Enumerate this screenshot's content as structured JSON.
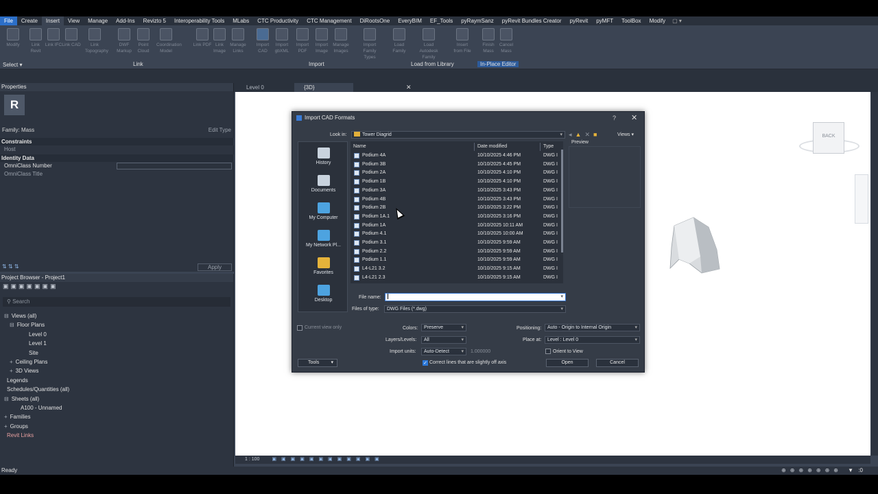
{
  "ribbon_tabs": [
    "File",
    "Create",
    "Insert",
    "View",
    "Manage",
    "Add-Ins",
    "Revizto 5",
    "Interoperability Tools",
    "MLabs",
    "CTC Productivity",
    "CTC Management",
    "DiRootsOne",
    "EveryBIM",
    "EF_Tools",
    "pyRaymSanz",
    "pyRevit Bundles Creator",
    "pyRevit",
    "pyMFT",
    "ToolBox",
    "Modify"
  ],
  "ribbon": {
    "buttons": [
      {
        "label": "Modify",
        "highlight": false
      },
      {
        "label": "Link Revit",
        "highlight": false
      },
      {
        "label": "Link IFC",
        "highlight": false
      },
      {
        "label": "Link CAD",
        "highlight": false
      },
      {
        "label": "Link Topography",
        "highlight": false
      },
      {
        "label": "DWF Markup",
        "highlight": false
      },
      {
        "label": "Point Cloud",
        "highlight": false
      },
      {
        "label": "Coordination Model",
        "highlight": false
      },
      {
        "label": "Link PDF",
        "highlight": false
      },
      {
        "label": "Link Image",
        "highlight": false
      },
      {
        "label": "Manage Links",
        "highlight": false
      },
      {
        "label": "Import CAD",
        "highlight": true
      },
      {
        "label": "Import gbXML",
        "highlight": false
      },
      {
        "label": "Import PDF",
        "highlight": false
      },
      {
        "label": "Import Image",
        "highlight": false
      },
      {
        "label": "Manage Images",
        "highlight": false
      },
      {
        "label": "Import Family Types",
        "highlight": false
      },
      {
        "label": "Load Family",
        "highlight": false
      },
      {
        "label": "Load Autodesk Family",
        "highlight": false
      },
      {
        "label": "Insert from File",
        "highlight": false
      },
      {
        "label": "Finish Mass",
        "highlight": false
      },
      {
        "label": "Cancel Mass",
        "highlight": false
      }
    ],
    "panels": {
      "select": "Select ▾",
      "link": "Link",
      "import": "Import",
      "load": "Load from Library",
      "inplace": "In-Place Editor"
    }
  },
  "properties": {
    "title": "Properties",
    "logo": "R",
    "family": "Family: Mass",
    "edit_type": "Edit Type",
    "sections": {
      "constraints": "Constraints",
      "identity": "Identity Data"
    },
    "rows": {
      "host": "Host",
      "omniclass_number": "OmniClass Number",
      "omniclass_title": "OmniClass Title"
    },
    "apply": "Apply"
  },
  "browser": {
    "title": "Project Browser - Project1",
    "search_placeholder": "Search",
    "items": [
      {
        "label": "Views (all)",
        "twist": "⊟",
        "indent": 6
      },
      {
        "label": "Floor Plans",
        "twist": "⊟",
        "indent": 14
      },
      {
        "label": "Level 0",
        "twist": "",
        "indent": 38
      },
      {
        "label": "Level 1",
        "twist": "",
        "indent": 38
      },
      {
        "label": "Site",
        "twist": "",
        "indent": 38
      },
      {
        "label": "Ceiling Plans",
        "twist": "+",
        "indent": 14
      },
      {
        "label": "3D Views",
        "twist": "+",
        "indent": 14
      },
      {
        "label": "Legends",
        "twist": "",
        "indent": 6
      },
      {
        "label": "Schedules/Quantities (all)",
        "twist": "",
        "indent": 6
      },
      {
        "label": "Sheets (all)",
        "twist": "⊟",
        "indent": 6
      },
      {
        "label": "A100 - Unnamed",
        "twist": "",
        "indent": 26
      },
      {
        "label": "Families",
        "twist": "+",
        "indent": 6
      },
      {
        "label": "Groups",
        "twist": "+",
        "indent": 6
      },
      {
        "label": "Revit Links",
        "twist": "",
        "indent": 6
      }
    ]
  },
  "view_tabs": {
    "level0": "Level 0",
    "3d": "{3D}"
  },
  "view_status": {
    "scale": "1 : 100"
  },
  "viewcube": {
    "label": "BACK"
  },
  "status": {
    "text": "Ready",
    "right": ":0"
  },
  "dialog": {
    "title": "Import CAD Formats",
    "help": "?",
    "look_in_label": "Look in:",
    "look_in_value": "Tower Diagrid",
    "views_btn": "Views",
    "preview": "Preview",
    "places": [
      "History",
      "Documents",
      "My Computer",
      "My Network Pl...",
      "Favorites",
      "Desktop"
    ],
    "columns": {
      "name": "Name",
      "date": "Date modified",
      "type": "Type"
    },
    "files": [
      {
        "name": "Podium 4A",
        "date": "10/10/2025 4:46 PM",
        "type": "DWG I"
      },
      {
        "name": "Podium 3B",
        "date": "10/10/2025 4:45 PM",
        "type": "DWG I"
      },
      {
        "name": "Podium 2A",
        "date": "10/10/2025 4:10 PM",
        "type": "DWG I"
      },
      {
        "name": "Podium 1B",
        "date": "10/10/2025 4:10 PM",
        "type": "DWG I"
      },
      {
        "name": "Podium 3A",
        "date": "10/10/2025 3:43 PM",
        "type": "DWG I"
      },
      {
        "name": "Podium 4B",
        "date": "10/10/2025 3:43 PM",
        "type": "DWG I"
      },
      {
        "name": "Podium 2B",
        "date": "10/10/2025 3:22 PM",
        "type": "DWG I"
      },
      {
        "name": "Podium 1A.1",
        "date": "10/10/2025 3:16 PM",
        "type": "DWG I"
      },
      {
        "name": "Podium 1A",
        "date": "10/10/2025 10:11 AM",
        "type": "DWG I"
      },
      {
        "name": "Podium 4.1",
        "date": "10/10/2025 10:00 AM",
        "type": "DWG I"
      },
      {
        "name": "Podium 3.1",
        "date": "10/10/2025 9:59 AM",
        "type": "DWG I"
      },
      {
        "name": "Podium 2.2",
        "date": "10/10/2025 9:59 AM",
        "type": "DWG I"
      },
      {
        "name": "Podium 1.1",
        "date": "10/10/2025 9:59 AM",
        "type": "DWG I"
      },
      {
        "name": "L4-L21 3.2",
        "date": "10/10/2025 9:15 AM",
        "type": "DWG I"
      },
      {
        "name": "L4-L21 2.3",
        "date": "10/10/2025 9:15 AM",
        "type": "DWG I"
      }
    ],
    "file_name_label": "File name:",
    "file_name_value": "",
    "files_of_type_label": "Files of type:",
    "files_of_type_value": "DWG Files (*.dwg)",
    "current_view_only": "Current view only",
    "colors_label": "Colors:",
    "colors_value": "Preserve",
    "layers_label": "Layers/Levels:",
    "layers_value": "All",
    "units_label": "Import units:",
    "units_value": "Auto-Detect",
    "units_scale": "1.000000",
    "correct_lines": "Correct lines that are slightly off axis",
    "positioning_label": "Positioning:",
    "positioning_value": "Auto - Origin to Internal Origin",
    "place_at_label": "Place at:",
    "place_at_value": "Level : Level 0",
    "orient_to_view": "Orient to View",
    "tools": "Tools",
    "open": "Open",
    "cancel": "Cancel"
  }
}
